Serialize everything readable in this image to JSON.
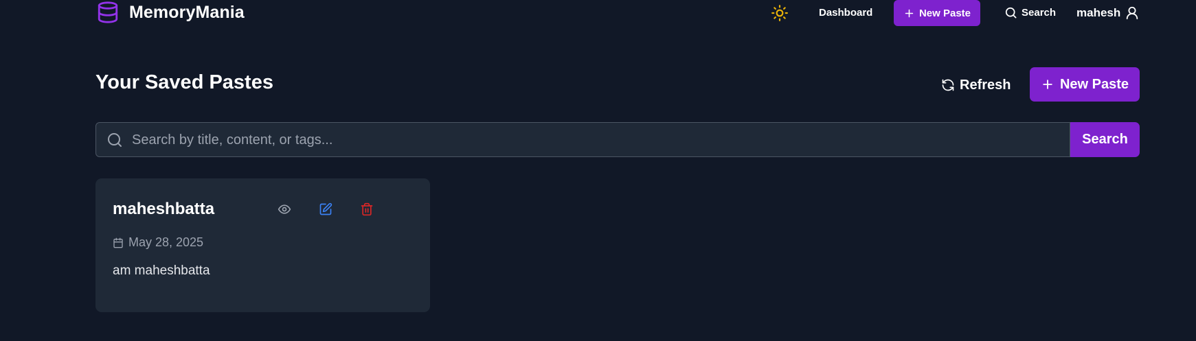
{
  "nav": {
    "brand": "MemoryMania",
    "links": {
      "dashboard": "Dashboard"
    },
    "new_paste": "New Paste",
    "search": "Search",
    "username": "mahesh"
  },
  "header": {
    "title": "Your Saved Pastes",
    "refresh_label": "Refresh",
    "new_paste_label": "New Paste"
  },
  "search": {
    "placeholder": "Search by title, content, or tags...",
    "value": "",
    "button_label": "Search"
  },
  "pastes": [
    {
      "title": "maheshbatta",
      "date": "May 28, 2025",
      "content": "am maheshbatta"
    }
  ],
  "colors": {
    "background": "#111827",
    "surface": "#1f2937",
    "accent": "#7e22ce",
    "sun": "#eab308",
    "edit": "#3b82f6",
    "delete": "#dc2626",
    "muted": "#9ca3af"
  },
  "icons": [
    "database-icon",
    "sun-icon",
    "plus-icon",
    "search-icon",
    "user-icon",
    "refresh-icon",
    "eye-icon",
    "edit-icon",
    "trash-icon",
    "calendar-icon"
  ]
}
